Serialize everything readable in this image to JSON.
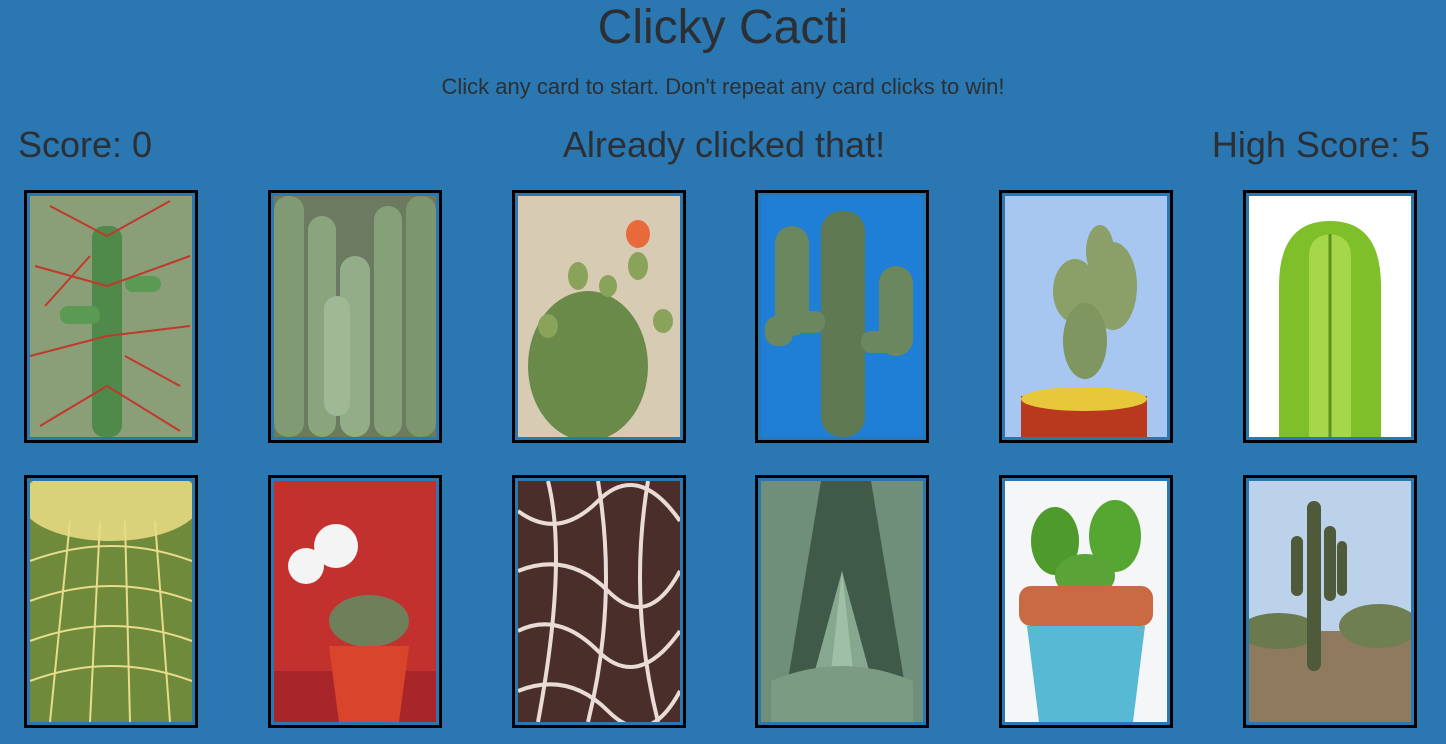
{
  "app": {
    "title": "Clicky Cacti",
    "instructions": "Click any card to start. Don't repeat any card clicks to win!"
  },
  "scorebar": {
    "score_label": "Score: 0",
    "message": "Already clicked that!",
    "high_score_label": "High Score: 5"
  },
  "cards": [
    {
      "name": "card-spiny-red-cactus"
    },
    {
      "name": "card-columnar-cactus-cluster"
    },
    {
      "name": "card-prickly-pear-flowers"
    },
    {
      "name": "card-saguaro-blue-sky"
    },
    {
      "name": "card-bunny-ear-cactus-pot"
    },
    {
      "name": "card-green-column-cactus"
    },
    {
      "name": "card-golden-barrel-cactus"
    },
    {
      "name": "card-flowering-cactus-red-pot"
    },
    {
      "name": "card-cactus-skeleton"
    },
    {
      "name": "card-agave-leaves"
    },
    {
      "name": "card-jade-plant-blue-pot"
    },
    {
      "name": "card-saguaro-desert"
    }
  ]
}
